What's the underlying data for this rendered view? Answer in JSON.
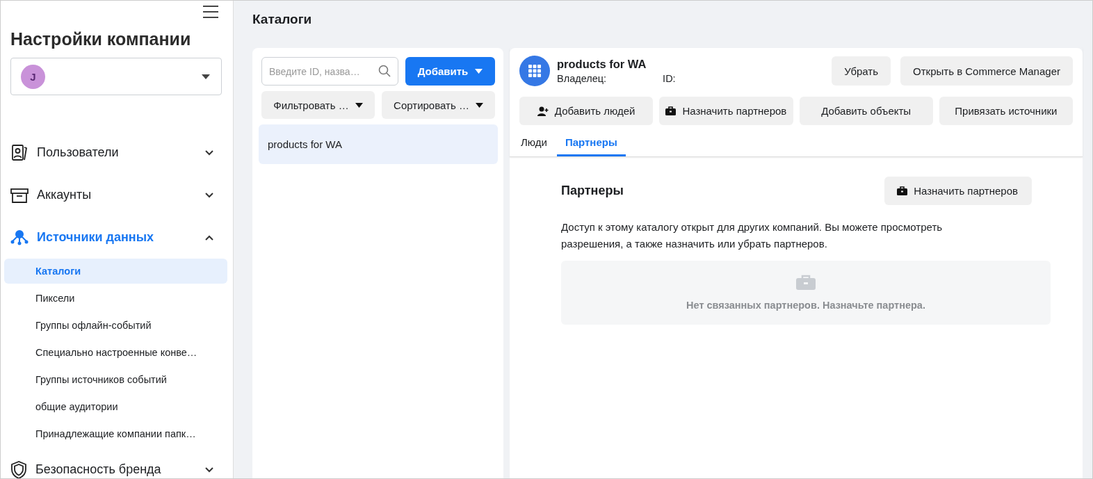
{
  "sidebar": {
    "title": "Настройки компании",
    "account": {
      "avatar_letter": "J"
    },
    "sections": [
      {
        "label": "Пользователи",
        "kind": "users",
        "expanded": false,
        "selected": false
      },
      {
        "label": "Аккаунты",
        "kind": "accounts",
        "expanded": false,
        "selected": false
      },
      {
        "label": "Источники данных",
        "kind": "data",
        "expanded": true,
        "selected": true,
        "children": [
          {
            "label": "Каталоги",
            "selected": true
          },
          {
            "label": "Пиксели",
            "selected": false
          },
          {
            "label": "Группы офлайн-событий",
            "selected": false
          },
          {
            "label": "Специально настроенные конве…",
            "selected": false
          },
          {
            "label": "Группы источников событий",
            "selected": false
          },
          {
            "label": "общие аудитории",
            "selected": false
          },
          {
            "label": "Принадлежащие компании папк…",
            "selected": false
          }
        ]
      },
      {
        "label": "Безопасность бренда",
        "kind": "shield",
        "expanded": false,
        "selected": false
      }
    ]
  },
  "page_title": "Каталоги",
  "list_panel": {
    "search": {
      "placeholder": "Введите ID, назва…"
    },
    "add_button": "Добавить",
    "filter_button": "Фильтровать …",
    "sort_button": "Сортировать …",
    "items": [
      {
        "label": "products for WA",
        "selected": true
      }
    ]
  },
  "detail": {
    "title": "products for WA",
    "owner_label": "Владелец:",
    "id_label": "ID:",
    "top_buttons": [
      "Убрать",
      "Открыть в Commerce Manager"
    ],
    "actions": [
      {
        "label": "Добавить людей",
        "kind": "person"
      },
      {
        "label": "Назначить партнеров",
        "kind": "briefcase"
      },
      {
        "label": "Добавить объекты",
        "kind": "plain"
      },
      {
        "label": "Привязать источники",
        "kind": "plain"
      }
    ],
    "tabs": [
      {
        "label": "Люди",
        "selected": false
      },
      {
        "label": "Партнеры",
        "selected": true
      }
    ],
    "section": {
      "heading": "Партнеры",
      "button": "Назначить партнеров",
      "description": "Доступ к этому каталогу открыт для других компаний. Вы можете просмотреть разрешения, а также назначить или убрать партнеров.",
      "empty_text": "Нет связанных партнеров. Назначьте партнера."
    }
  }
}
